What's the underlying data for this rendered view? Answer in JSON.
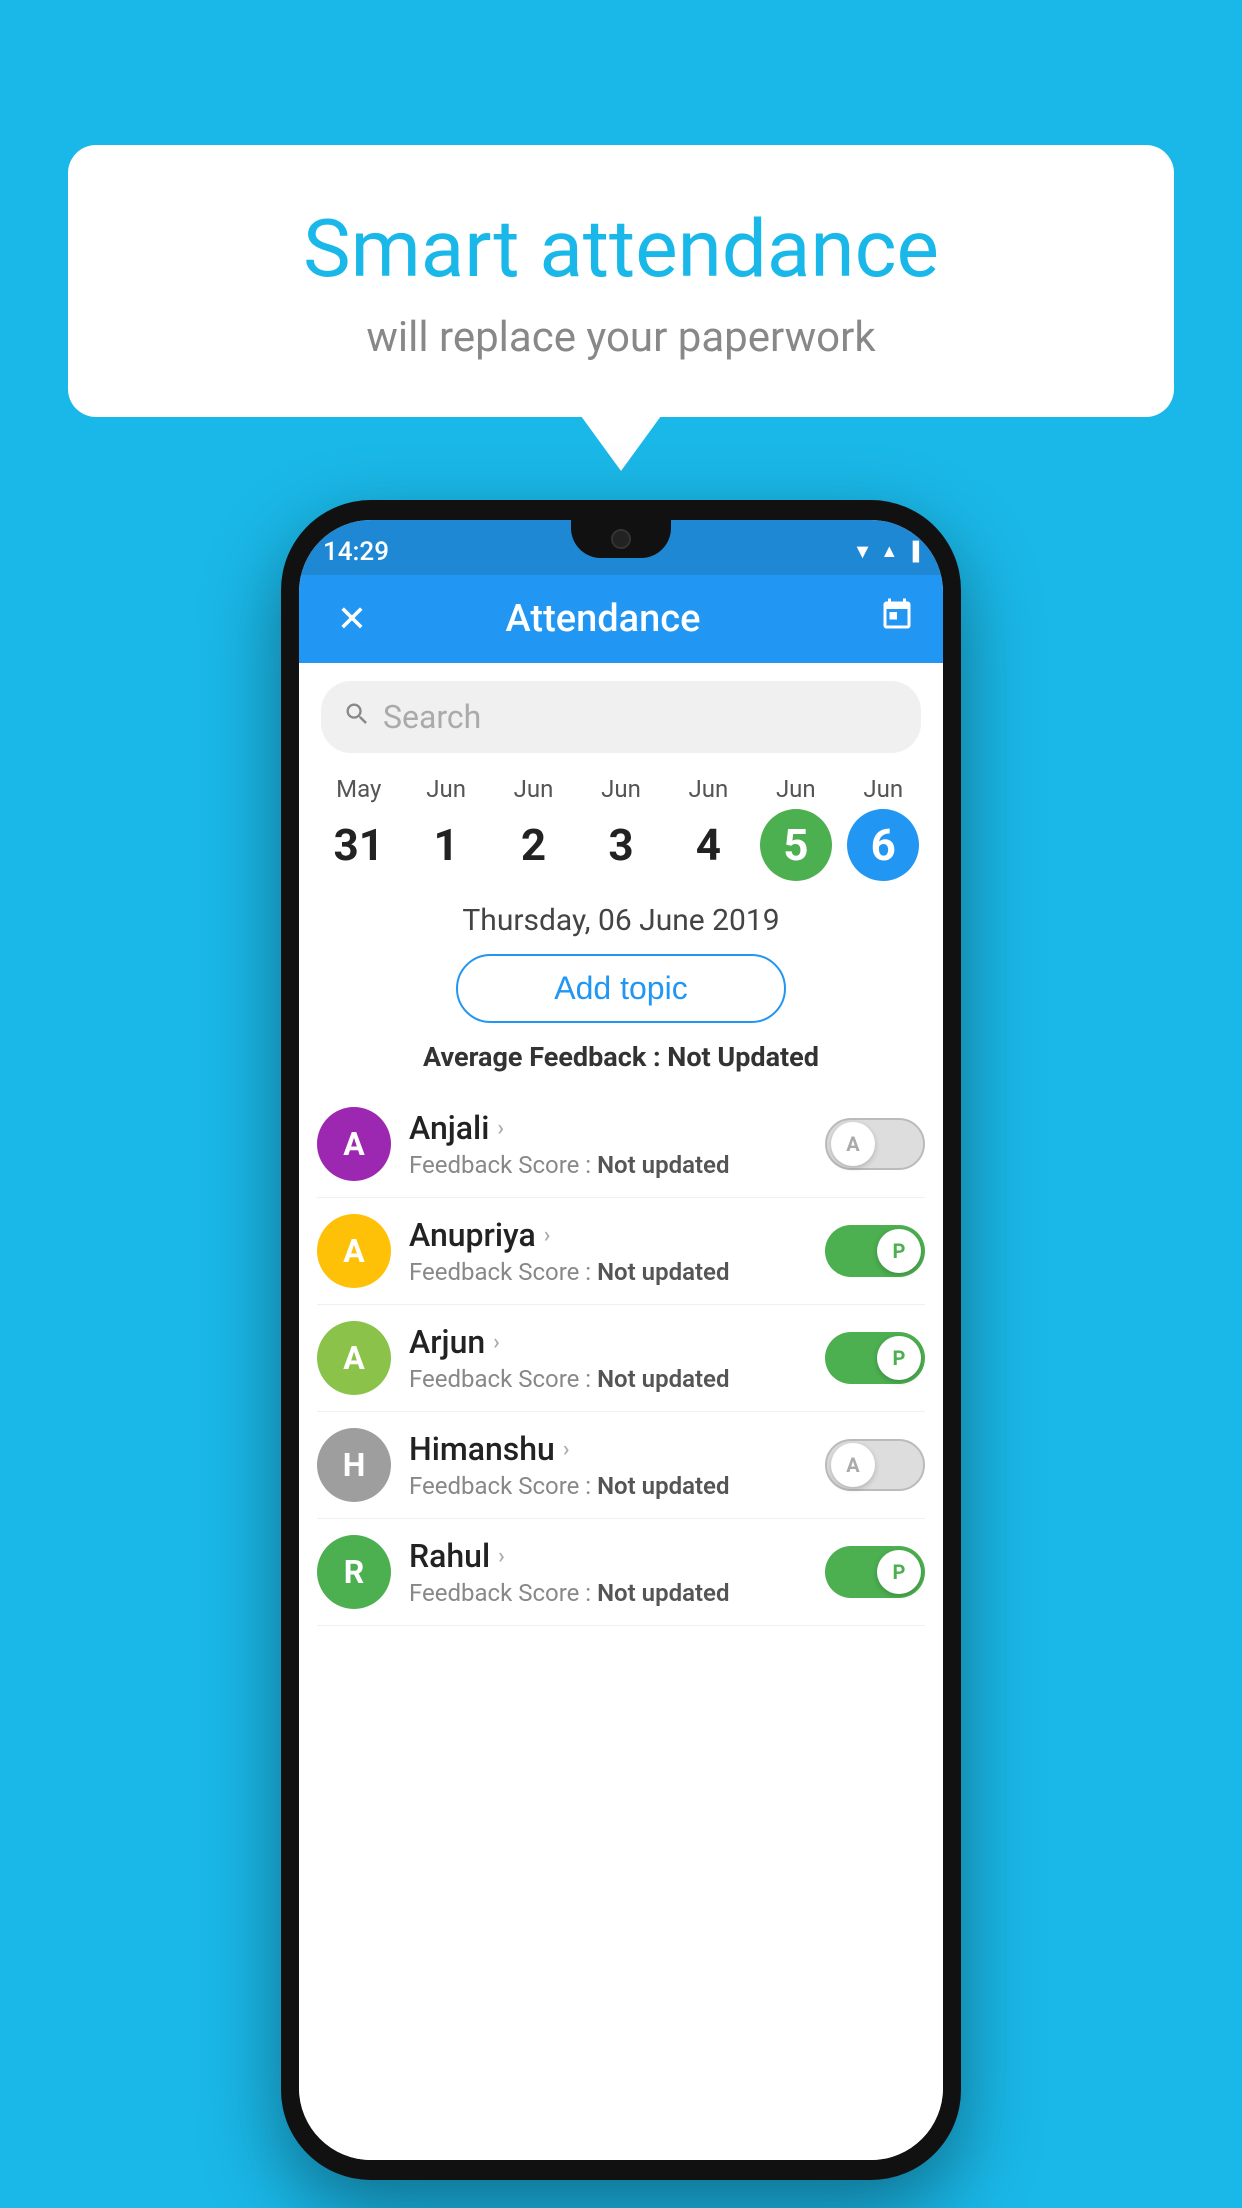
{
  "background_color": "#1ab8e8",
  "speech_bubble": {
    "title": "Smart attendance",
    "subtitle": "will replace your paperwork"
  },
  "status_bar": {
    "time": "14:29",
    "wifi": "▲",
    "signal": "▲",
    "battery": "▪"
  },
  "header": {
    "title": "Attendance",
    "close_label": "✕",
    "calendar_icon": "📅"
  },
  "search": {
    "placeholder": "Search"
  },
  "calendar": {
    "days": [
      {
        "month": "May",
        "date": "31",
        "state": "normal"
      },
      {
        "month": "Jun",
        "date": "1",
        "state": "normal"
      },
      {
        "month": "Jun",
        "date": "2",
        "state": "normal"
      },
      {
        "month": "Jun",
        "date": "3",
        "state": "normal"
      },
      {
        "month": "Jun",
        "date": "4",
        "state": "normal"
      },
      {
        "month": "Jun",
        "date": "5",
        "state": "today"
      },
      {
        "month": "Jun",
        "date": "6",
        "state": "selected"
      }
    ]
  },
  "selected_date": "Thursday, 06 June 2019",
  "add_topic_label": "Add topic",
  "avg_feedback_label": "Average Feedback :",
  "avg_feedback_value": "Not Updated",
  "students": [
    {
      "name": "Anjali",
      "avatar_letter": "A",
      "avatar_color": "#9c27b0",
      "score_label": "Feedback Score :",
      "score_value": "Not updated",
      "attendance": "absent"
    },
    {
      "name": "Anupriya",
      "avatar_letter": "A",
      "avatar_color": "#ffc107",
      "score_label": "Feedback Score :",
      "score_value": "Not updated",
      "attendance": "present"
    },
    {
      "name": "Arjun",
      "avatar_letter": "A",
      "avatar_color": "#8bc34a",
      "score_label": "Feedback Score :",
      "score_value": "Not updated",
      "attendance": "present"
    },
    {
      "name": "Himanshu",
      "avatar_letter": "H",
      "avatar_color": "#9e9e9e",
      "score_label": "Feedback Score :",
      "score_value": "Not updated",
      "attendance": "absent"
    },
    {
      "name": "Rahul",
      "avatar_letter": "R",
      "avatar_color": "#4caf50",
      "score_label": "Feedback Score :",
      "score_value": "Not updated",
      "attendance": "present"
    }
  ],
  "toggle_labels": {
    "present": "P",
    "absent": "A"
  }
}
